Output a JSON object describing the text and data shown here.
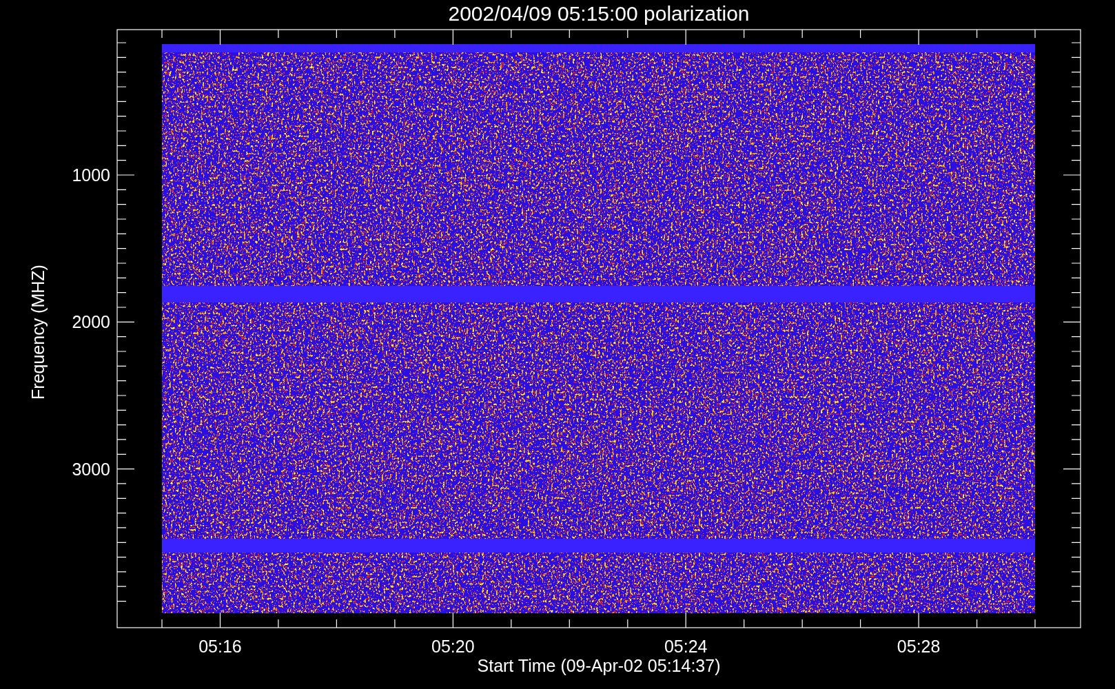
{
  "plot": {
    "title": "2002/04/09 05:15:00 polarization",
    "y_axis": {
      "label": "Frequency (MHZ)",
      "tick_labels": [
        "1000",
        "2000",
        "3000"
      ]
    },
    "x_axis": {
      "label": "Start Time (09-Apr-02 05:14:37)",
      "tick_labels": [
        "05:16",
        "05:20",
        "05:24",
        "05:28"
      ]
    }
  }
}
